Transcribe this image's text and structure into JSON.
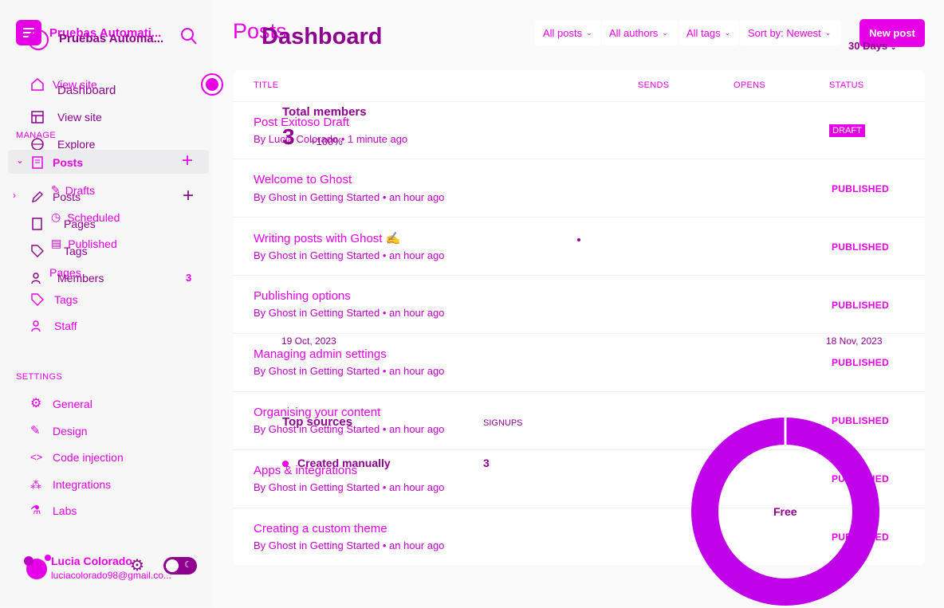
{
  "sidebar": {
    "site_name": "Pruebas Automati...",
    "site_name_overlay": "Pruebas Automa...",
    "nav_top": [
      {
        "label": "View site"
      },
      {
        "label": "Dashboard"
      },
      {
        "label": "View site"
      },
      {
        "label": "Explore"
      }
    ],
    "manage_label": "MANAGE",
    "posts_label": "Posts",
    "posts_overlay_label": "Posts",
    "drafts_label": "Drafts",
    "scheduled_label": "Scheduled",
    "published_label": "Published",
    "pages_label": "Pages",
    "pages_label2": "Pages",
    "tags_label": "Tags",
    "tags_label2": "Tags",
    "members_label": "Members",
    "members_count": "3",
    "staff_label": "Staff",
    "settings_label": "SETTINGS",
    "settings_items": [
      {
        "label": "General"
      },
      {
        "label": "Design"
      },
      {
        "label": "Code injection"
      },
      {
        "label": "Integrations"
      },
      {
        "label": "Labs"
      }
    ],
    "user_name": "Lucia Colorado",
    "user_email": "luciacolorado98@gmail.co..."
  },
  "header": {
    "title": "Posts",
    "title_overlay": "Dashboard",
    "filters": [
      "All posts",
      "All authors",
      "All tags",
      "Sort by: Newest"
    ],
    "new_post": "New post",
    "range": "30 Days"
  },
  "table": {
    "headers": {
      "title": "TITLE",
      "sends": "SENDS",
      "opens": "OPENS",
      "status": "STATUS"
    },
    "rows": [
      {
        "title": "Post Exitoso Draft",
        "meta": "By Lucia Colorado • 1 minute ago",
        "status": "DRAFT"
      },
      {
        "title": "Welcome to Ghost",
        "meta": "By Ghost in Getting Started • an hour ago",
        "status": "PUBLISHED"
      },
      {
        "title": "Writing posts with Ghost ✍️",
        "meta": "By Ghost in Getting Started • an hour ago",
        "status": "PUBLISHED"
      },
      {
        "title": "Publishing options",
        "meta": "By Ghost in Getting Started • an hour ago",
        "status": "PUBLISHED"
      },
      {
        "title": "Managing admin settings",
        "meta": "By Ghost in Getting Started • an hour ago",
        "status": "PUBLISHED"
      },
      {
        "title": "Organising your content",
        "meta": "By Ghost in Getting Started • an hour ago",
        "status": "PUBLISHED"
      },
      {
        "title": "Apps & integrations",
        "meta": "By Ghost in Getting Started • an hour ago",
        "status": "PUBLISHED"
      },
      {
        "title": "Creating a custom theme",
        "meta": "By Ghost in Getting Started • an hour ago",
        "status": "PUBLISHED"
      }
    ]
  },
  "dashboard_overlay": {
    "total_members_label": "Total members",
    "total_members_value": "3",
    "total_members_change": "+100%",
    "date_start": "19 Oct, 2023",
    "date_end": "18 Nov, 2023",
    "top_sources_label": "Top sources",
    "signups_label": "SIGNUPS",
    "source_name": "Created manually",
    "source_value": "3",
    "donut_label": "Free"
  },
  "colors": {
    "accent": "#e600e6",
    "dark": "#8f0090",
    "donut": "#c000e8"
  }
}
